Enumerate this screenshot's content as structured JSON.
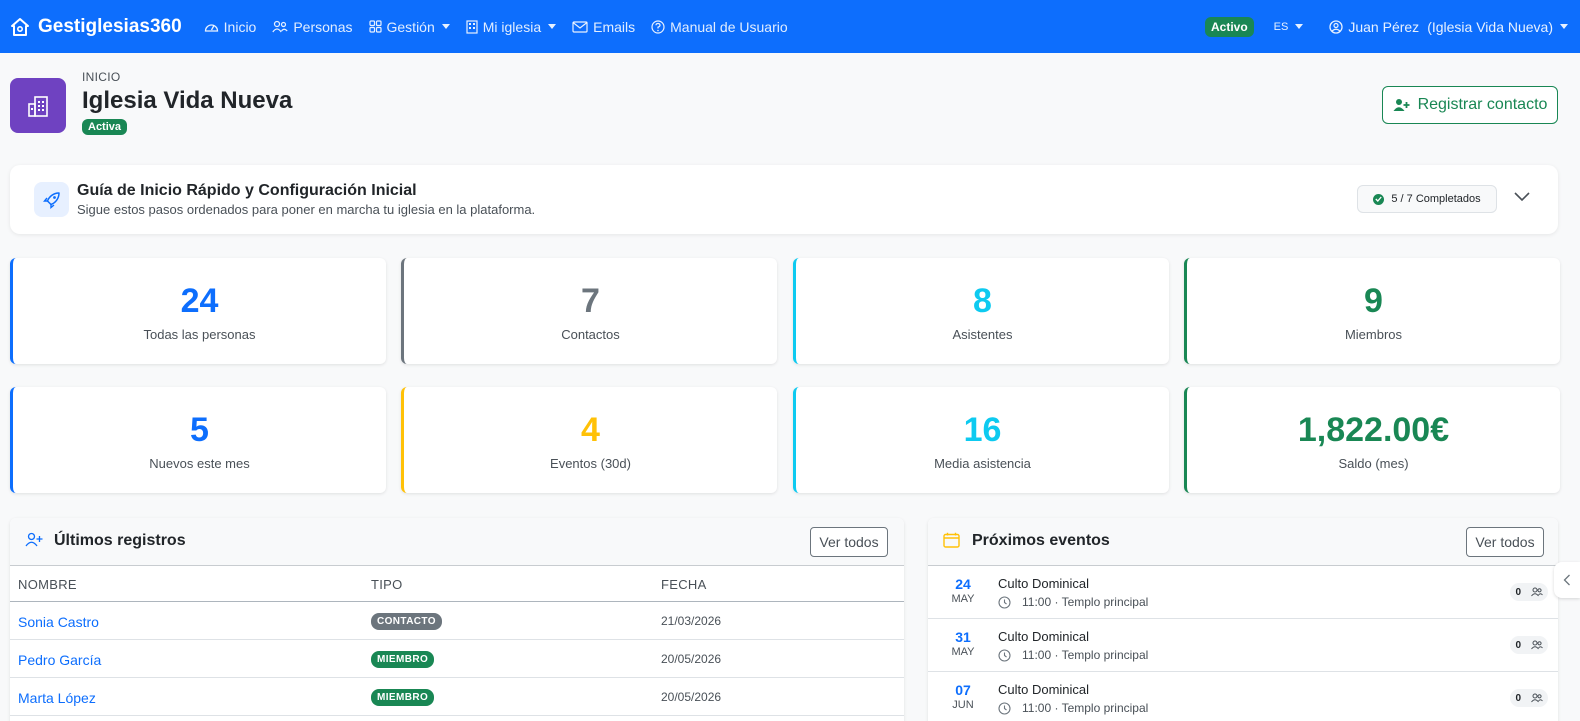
{
  "nav": {
    "brand": "Gestiglesias360",
    "links": [
      {
        "label": "Inicio",
        "icon": "gauge-icon",
        "dropdown": false
      },
      {
        "label": "Personas",
        "icon": "people-icon",
        "dropdown": false
      },
      {
        "label": "Gestión",
        "icon": "grid-icon",
        "dropdown": true
      },
      {
        "label": "Mi iglesia",
        "icon": "building-icon",
        "dropdown": true
      },
      {
        "label": "Emails",
        "icon": "envelope-icon",
        "dropdown": false
      },
      {
        "label": "Manual de Usuario",
        "icon": "question-circle-icon",
        "dropdown": false
      }
    ],
    "status": "Activo",
    "language": "ES",
    "user_name": "Juan Pérez",
    "user_church": "(Iglesia Vida Nueva)"
  },
  "header": {
    "breadcrumb": "INICIO",
    "church_name": "Iglesia Vida Nueva",
    "status": "Activa",
    "register_button": "Registrar contacto"
  },
  "guide": {
    "title": "Guía de Inicio Rápido y Configuración Inicial",
    "subtitle": "Sigue estos pasos ordenados para poner en marcha tu iglesia en la plataforma.",
    "progress_label": "5 / 7 Completados",
    "completed": 5,
    "total": 7
  },
  "stats": [
    {
      "value": "24",
      "label": "Todas las personas",
      "color": "#0d6efd"
    },
    {
      "value": "7",
      "label": "Contactos",
      "color": "#6c757d"
    },
    {
      "value": "8",
      "label": "Asistentes",
      "color": "#0dcaf0"
    },
    {
      "value": "9",
      "label": "Miembros",
      "color": "#198754"
    },
    {
      "value": "5",
      "label": "Nuevos este mes",
      "color": "#0d6efd"
    },
    {
      "value": "4",
      "label": "Eventos (30d)",
      "color": "#ffc107"
    },
    {
      "value": "16",
      "label": "Media asistencia",
      "color": "#0dcaf0"
    },
    {
      "value": "1,822.00€",
      "label": "Saldo (mes)",
      "color": "#198754"
    }
  ],
  "registros": {
    "title": "Últimos registros",
    "view_all": "Ver todos",
    "columns": [
      "NOMBRE",
      "TIPO",
      "FECHA"
    ],
    "rows": [
      {
        "name": "Sonia Castro",
        "type": "CONTACTO",
        "type_color": "#6c757d",
        "date": "21/03/2026"
      },
      {
        "name": "Pedro García",
        "type": "MIEMBRO",
        "type_color": "#198754",
        "date": "20/05/2026"
      },
      {
        "name": "Marta López",
        "type": "MIEMBRO",
        "type_color": "#198754",
        "date": "20/05/2026"
      }
    ]
  },
  "eventos": {
    "title": "Próximos eventos",
    "view_all": "Ver todos",
    "items": [
      {
        "day": "24",
        "month": "MAY",
        "title": "Culto Dominical",
        "meta": "11:00 · Templo principal",
        "count": "0"
      },
      {
        "day": "31",
        "month": "MAY",
        "title": "Culto Dominical",
        "meta": "11:00 · Templo principal",
        "count": "0"
      },
      {
        "day": "07",
        "month": "JUN",
        "title": "Culto Dominical",
        "meta": "11:00 · Templo principal",
        "count": "0"
      }
    ]
  }
}
